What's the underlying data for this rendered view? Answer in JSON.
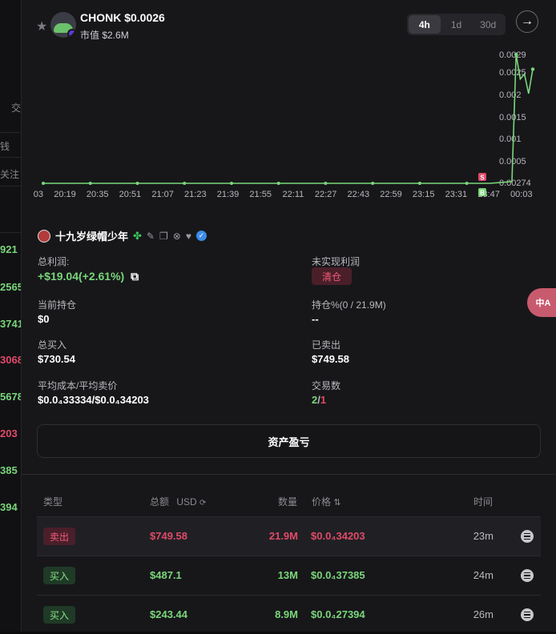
{
  "background": {
    "numbers": [
      {
        "text": "921",
        "color": "#7ad67a"
      },
      {
        "text": "2565",
        "color": "#7ad67a"
      },
      {
        "text": "3741",
        "color": "#7ad67a"
      },
      {
        "text": "3068",
        "color": "#e04a68"
      },
      {
        "text": "5678",
        "color": "#7ad67a"
      },
      {
        "text": "203",
        "color": "#e04a68"
      },
      {
        "text": "385",
        "color": "#7ad67a"
      },
      {
        "text": "394",
        "color": "#7ad67a"
      }
    ],
    "texts": [
      "交",
      "钱",
      "关注"
    ]
  },
  "header": {
    "token_name": "CHONK $0.0026",
    "market_cap": "市值 $2.6M",
    "timeframes": [
      "4h",
      "1d",
      "30d"
    ],
    "active_timeframe": "4h",
    "arrow_icon": "arrow-right-icon"
  },
  "chart_data": {
    "type": "line",
    "y_tick_labels": [
      "0.0029",
      "0.0025",
      "0.002",
      "0.0015",
      "0.001",
      "0.0005",
      "0.00274"
    ],
    "x_tick_labels": [
      "03",
      "20:19",
      "20:35",
      "20:51",
      "21:07",
      "21:23",
      "21:39",
      "21:55",
      "22:11",
      "22:27",
      "22:43",
      "22:59",
      "23:15",
      "23:31",
      "23:47",
      "00:03"
    ],
    "ylim": [
      0.000274,
      0.0029
    ],
    "series": [
      {
        "color": "#7ad67a",
        "values": [
          0.000274,
          0.000274,
          0.000274,
          0.000274,
          0.000274,
          0.000274,
          0.000274,
          0.000274,
          0.000274,
          0.000274,
          0.000274,
          0.000274,
          0.000274,
          0.000274,
          0.000274,
          0.000274,
          0.000274,
          0.000274,
          0.000274,
          0.000274,
          0.00031,
          0.0029,
          0.0024,
          0.0025,
          0.0021,
          0.0026
        ]
      }
    ],
    "markers": [
      {
        "label": "S",
        "color": "#e04a68"
      },
      {
        "label": "B",
        "color": "#7ad67a"
      }
    ]
  },
  "user": {
    "name": "十九岁绿帽少年",
    "icons": [
      "clover-icon",
      "pen-icon",
      "copy-icon",
      "x-icon",
      "heart-icon",
      "verified-icon"
    ]
  },
  "stats": {
    "total_profit_label": "总利润:",
    "total_profit_value": "+$19.04(+2.61%)",
    "unrealized_label": "未实现利润",
    "clear_label": "清仓",
    "holding_label": "当前持仓",
    "holding_value": "$0",
    "holding_pct_label": "持仓%(0 / 21.9M)",
    "holding_pct_value": "--",
    "total_buy_label": "总买入",
    "total_buy_value": "$730.54",
    "sold_label": "已卖出",
    "sold_value": "$749.58",
    "avg_label": "平均成本/平均卖价",
    "avg_value": "$0.0₄33334/$0.0₄34203",
    "trades_label": "交易数",
    "trades_buy": "2",
    "trades_sep": "/",
    "trades_sell": "1"
  },
  "pnl_button": "资产盈亏",
  "table": {
    "headers": {
      "type": "类型",
      "total": "总额",
      "currency": "USD",
      "qty": "数量",
      "price": "价格",
      "time": "时间"
    },
    "rows": [
      {
        "type": "卖出",
        "kind": "sell",
        "total": "$749.58",
        "qty": "21.9M",
        "price": "$0.0₄34203",
        "time": "23m"
      },
      {
        "type": "买入",
        "kind": "buy",
        "total": "$487.1",
        "qty": "13M",
        "price": "$0.0₄37385",
        "time": "24m"
      },
      {
        "type": "买入",
        "kind": "buy",
        "total": "$243.44",
        "qty": "8.9M",
        "price": "$0.0₄27394",
        "time": "26m"
      }
    ]
  },
  "translate_fab": "中A"
}
